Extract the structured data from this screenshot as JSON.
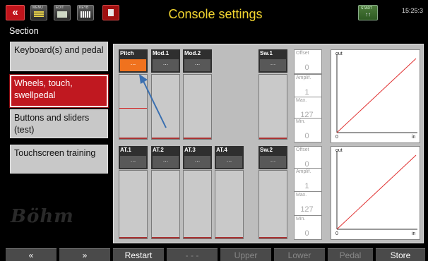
{
  "topbar": {
    "back_label": "«",
    "icons": [
      {
        "name": "menu-icon",
        "label": "MENU"
      },
      {
        "name": "edit-icon",
        "label": "EDIT"
      },
      {
        "name": "keyboard-icon",
        "label": "KEYB"
      },
      {
        "name": "single-manual-icon",
        "label": ""
      }
    ],
    "title": "Console settings",
    "rhythm_label": "START",
    "rhythm_glyph": "↑↑",
    "clock": "15:25:3"
  },
  "section_label": "Section",
  "menu": [
    {
      "label": "Keyboard(s) and pedal",
      "active": false
    },
    {
      "label": "Wheels, touch, swellpedal",
      "active": true
    },
    {
      "label": "Buttons and sliders (test)",
      "active": false
    },
    {
      "label": "Touchscreen training",
      "active": false
    }
  ],
  "logo": "Böhm",
  "channels_top": [
    {
      "name": "Pitch",
      "value": "...",
      "selected": true
    },
    {
      "name": "Mod.1",
      "value": "...",
      "selected": false
    },
    {
      "name": "Mod.2",
      "value": "...",
      "selected": false
    },
    {
      "name": "Sw.1",
      "value": "...",
      "selected": false
    }
  ],
  "channels_bottom": [
    {
      "name": "AT.1",
      "value": "..."
    },
    {
      "name": "AT.2",
      "value": "..."
    },
    {
      "name": "AT.3",
      "value": "..."
    },
    {
      "name": "AT.4",
      "value": "..."
    },
    {
      "name": "Sw.2",
      "value": "..."
    }
  ],
  "params_top": [
    {
      "label": "Offset",
      "value": "0"
    },
    {
      "label": "Amplif.",
      "value": "1"
    },
    {
      "label": "Max.",
      "value": "127"
    },
    {
      "label": "Min.",
      "value": "0"
    }
  ],
  "params_bottom": [
    {
      "label": "Offset",
      "value": "0"
    },
    {
      "label": "Amplif.",
      "value": "1"
    },
    {
      "label": "Max.",
      "value": "127"
    },
    {
      "label": "Min.",
      "value": "0"
    }
  ],
  "graph_top": {
    "out": "out",
    "in": "in",
    "zero": "0"
  },
  "graph_bottom": {
    "out": "out",
    "in": "in",
    "zero": "0"
  },
  "bottombar": [
    {
      "label": "«",
      "dim": false
    },
    {
      "label": "»",
      "dim": false
    },
    {
      "label": "Restart",
      "dim": false
    },
    {
      "label": "- - -",
      "dim": true
    },
    {
      "label": "Upper",
      "dim": true
    },
    {
      "label": "Lower",
      "dim": true
    },
    {
      "label": "Pedal",
      "dim": true
    },
    {
      "label": "Store",
      "dim": false
    }
  ],
  "colors": {
    "accent": "#c01820",
    "title": "#f2d530",
    "selected": "#f0721e",
    "arrow": "#3a6fb0"
  }
}
